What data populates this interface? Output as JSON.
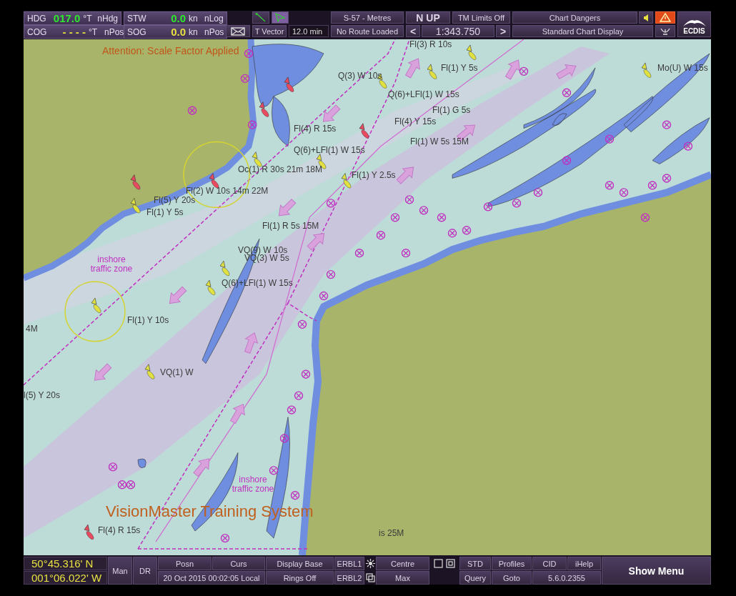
{
  "top_bar": {
    "heading": {
      "label": "HDG",
      "value": "017.0",
      "unit": "°T",
      "source": "nHdg"
    },
    "cog": {
      "label": "COG",
      "value": "- - - -",
      "unit": "°T",
      "source": "nPos"
    },
    "stw": {
      "label": "STW",
      "value": "0.0",
      "unit": "kn",
      "source": "nLog"
    },
    "sog": {
      "label": "SOG",
      "value": "0.0",
      "unit": "kn",
      "source": "nPos"
    },
    "vector": {
      "label": "T Vector",
      "value": "12.0 min"
    },
    "chart_format": "S-57 - Metres",
    "route": "No Route Loaded",
    "orientation": "N UP",
    "tm_limits": "TM Limits Off",
    "scale": {
      "prev": "<",
      "value": "1:343.750",
      "next": ">"
    },
    "alert": "Chart Dangers",
    "display": "Standard Chart Display",
    "alarm_active": true,
    "logo": "ECDIS"
  },
  "chart": {
    "notice": "Attention: Scale Factor Applied",
    "watermark": "VisionMaster Training System",
    "labels": [
      {
        "kind": "light",
        "text": "Fl(3) R 10s"
      },
      {
        "kind": "light",
        "text": "Q(3) W 10s"
      },
      {
        "kind": "light",
        "text": "Fl(1) Y 5s"
      },
      {
        "kind": "light",
        "text": "Q(6)+LFl(1) W 15s"
      },
      {
        "kind": "light",
        "text": "Fl(1) G 5s"
      },
      {
        "kind": "light",
        "text": "Fl(4) Y 15s"
      },
      {
        "kind": "light",
        "text": "Fl(1) W 5s 15M"
      },
      {
        "kind": "light",
        "text": "Fl(4) R 15s"
      },
      {
        "kind": "light",
        "text": "Q(6)+LFl(1) W 15s"
      },
      {
        "kind": "light",
        "text": "Oc(1) R 30s 21m 18M"
      },
      {
        "kind": "light",
        "text": "Fl(1) Y 2.5s"
      },
      {
        "kind": "light",
        "text": "Fl(2) W 10s 14m 22M"
      },
      {
        "kind": "light",
        "text": "Fl(5) Y 20s"
      },
      {
        "kind": "light",
        "text": "Fl(1) Y 5s"
      },
      {
        "kind": "light",
        "text": "Fl(1) R 5s 15M"
      },
      {
        "kind": "light",
        "text": "VQ(9) W 10s"
      },
      {
        "kind": "light",
        "text": "VQ(3) W 5s"
      },
      {
        "kind": "light",
        "text": "Q(6)+LFl(1) W 15s"
      },
      {
        "kind": "light",
        "text": "Fl(1) Y 10s"
      },
      {
        "kind": "light",
        "text": "4M"
      },
      {
        "kind": "light",
        "text": "VQ(1) W"
      },
      {
        "kind": "light",
        "text": "l(5) Y 20s"
      },
      {
        "kind": "light",
        "text": "Fl(4) R 15s"
      },
      {
        "kind": "light",
        "text": "Mo(U) W 15s"
      },
      {
        "kind": "light",
        "text": "is 25M"
      },
      {
        "kind": "zone",
        "text": "inshore traffic zone"
      },
      {
        "kind": "zone",
        "text": "inshore traffic zone"
      }
    ]
  },
  "bottom_bar": {
    "position": {
      "lat": "50°45.316' N",
      "lon": "001°06.022' W"
    },
    "mode_buttons": [
      "Man",
      "DR"
    ],
    "posn": "Posn",
    "curs": "Curs",
    "datetime": "20 Oct 2015 00:02:05 Local",
    "display_base": "Display Base",
    "rings": "Rings Off",
    "erbl1": "ERBL1",
    "erbl2": "ERBL2",
    "centre": "Centre",
    "max": "Max",
    "std": "STD",
    "query": "Query",
    "profiles": "Profiles",
    "goto": "Goto",
    "cid": "CID",
    "ihelp": "iHelp",
    "version": "5.6.0.2355",
    "show_menu": "Show Menu"
  }
}
